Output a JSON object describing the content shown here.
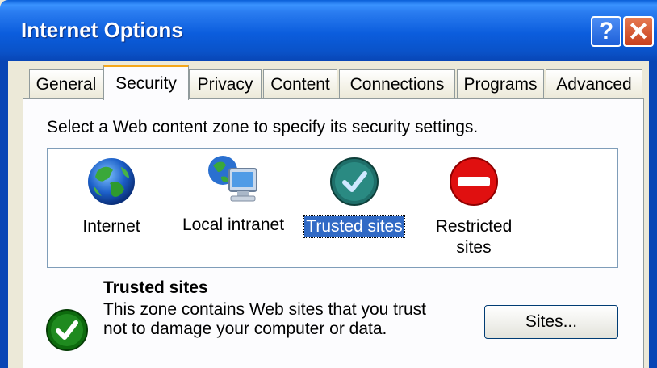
{
  "window": {
    "title": "Internet Options"
  },
  "titlebar": {
    "help_label": "?",
    "close_label": "✕"
  },
  "tabs": [
    {
      "label": "General"
    },
    {
      "label": "Security",
      "active": true
    },
    {
      "label": "Privacy"
    },
    {
      "label": "Content"
    },
    {
      "label": "Connections"
    },
    {
      "label": "Programs"
    },
    {
      "label": "Advanced"
    }
  ],
  "security": {
    "instruction": "Select a Web content zone to specify its security settings.",
    "zones": [
      {
        "label": "Internet",
        "icon": "globe-icon"
      },
      {
        "label": "Local intranet",
        "icon": "local-intranet-icon"
      },
      {
        "label": "Trusted sites",
        "icon": "trusted-sites-icon",
        "selected": true
      },
      {
        "label": "Restricted sites",
        "label_line1": "Restricted",
        "label_line2": "sites",
        "icon": "restricted-sites-icon"
      }
    ],
    "detail": {
      "title": "Trusted sites",
      "description": "This zone contains Web sites that you trust not to damage your computer or data."
    },
    "sites_button": "Sites..."
  },
  "colors": {
    "titlebar": "#0a52c8",
    "selection": "#316ac5",
    "tab_highlight": "#f4a71b",
    "trusted_green": "#1f7a1f",
    "restricted_red": "#e01010"
  }
}
